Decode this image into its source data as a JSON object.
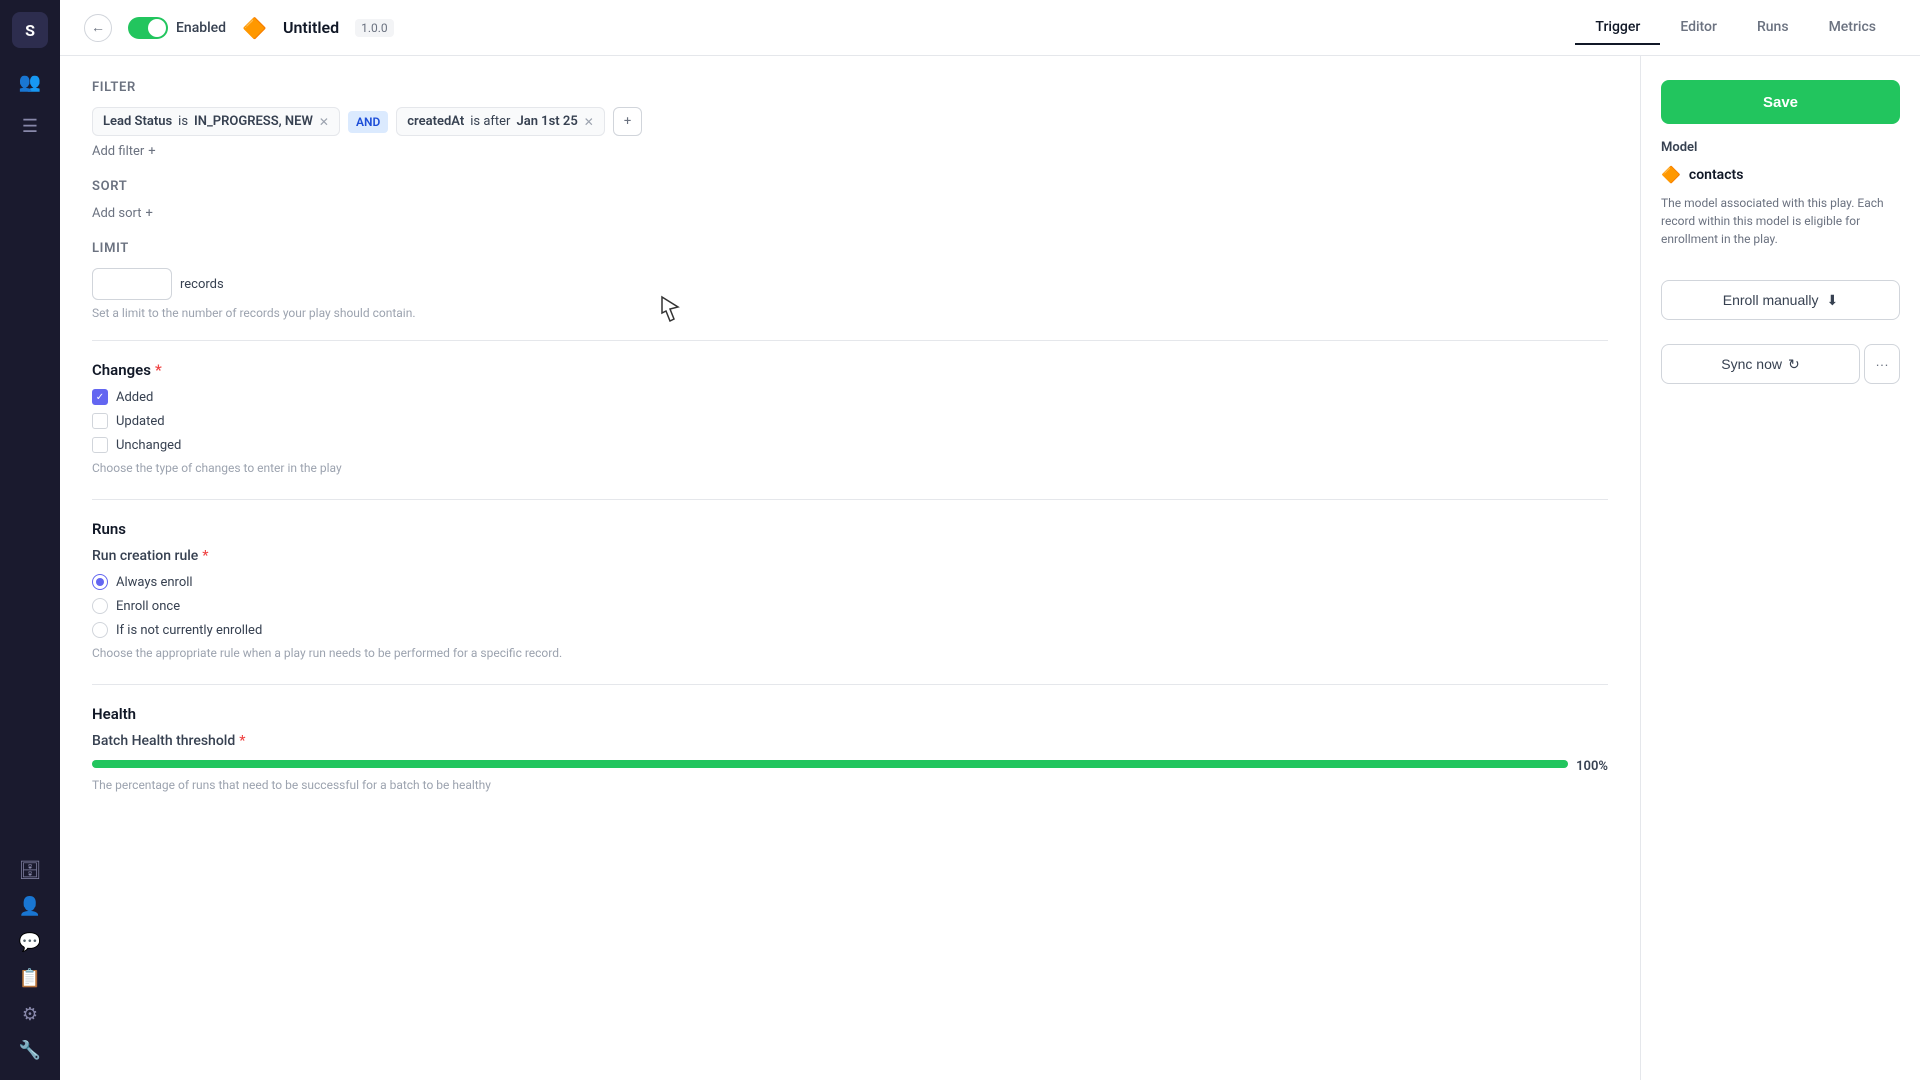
{
  "app": {
    "logo": "S",
    "sidebar_icons": [
      "↩",
      "👥",
      "☰",
      "📊",
      "💬",
      "📋",
      "⚙",
      "🔧"
    ]
  },
  "topbar": {
    "toggle_state": "Enabled",
    "workflow_title": "Untitled",
    "version": "1.0.0",
    "tabs": [
      "Trigger",
      "Editor",
      "Runs",
      "Metrics"
    ],
    "active_tab": "Trigger"
  },
  "filter": {
    "section_label": "Filter",
    "tag1_field": "Lead Status",
    "tag1_op": "is",
    "tag1_value": "IN_PROGRESS, NEW",
    "and_label": "AND",
    "tag2_field": "createdAt",
    "tag2_op": "is after",
    "tag2_value": "Jan 1st 25",
    "add_filter_label": "Add filter",
    "filter_icon": "+"
  },
  "sort": {
    "section_label": "Sort",
    "add_sort_label": "Add sort",
    "sort_icon": "+"
  },
  "limit": {
    "section_label": "Limit",
    "records_label": "records",
    "hint": "Set a limit to the number of records your play should contain."
  },
  "changes": {
    "section_label": "Changes",
    "required": "*",
    "options": [
      {
        "label": "Added",
        "checked": true
      },
      {
        "label": "Updated",
        "checked": false
      },
      {
        "label": "Unchanged",
        "checked": false
      }
    ],
    "hint": "Choose the type of changes to enter in the play"
  },
  "runs": {
    "section_label": "Runs",
    "rule_label": "Run creation rule",
    "required": "*",
    "options": [
      {
        "label": "Always enroll",
        "selected": true
      },
      {
        "label": "Enroll once",
        "selected": false
      },
      {
        "label": "If is not currently enrolled",
        "selected": false
      }
    ],
    "hint": "Choose the appropriate rule when a play run needs to be performed for a specific record."
  },
  "health": {
    "section_label": "Health",
    "threshold_label": "Batch Health threshold",
    "required": "*",
    "progress_value": 100,
    "progress_text": "100%",
    "hint": "The percentage of runs that need to be successful for a batch to be healthy"
  },
  "right_panel": {
    "save_label": "Save",
    "model_title": "Model",
    "model_name": "contacts",
    "model_desc": "The model associated with this play. Each record within this model is eligible for enrollment in the play.",
    "enroll_manually_label": "Enroll manually",
    "enroll_icon": "⬇",
    "sync_now_label": "Sync now",
    "sync_icon": "↻",
    "more_icon": "···"
  }
}
